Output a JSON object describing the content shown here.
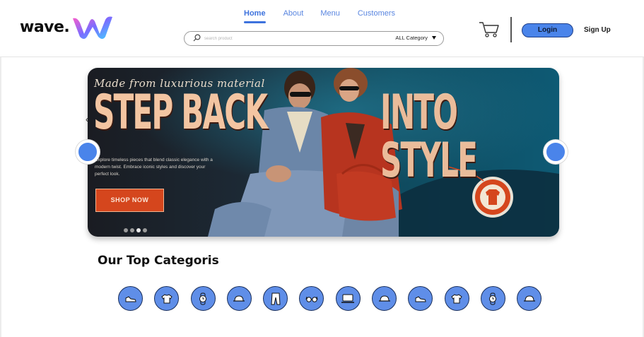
{
  "brand": {
    "name": "wave.",
    "accent": "#4a84ea",
    "logo_gradient": [
      "#ff5cc8",
      "#7b6cff",
      "#3fd0ff"
    ]
  },
  "nav": {
    "items": [
      {
        "label": "Home",
        "active": true
      },
      {
        "label": "About",
        "active": false
      },
      {
        "label": "Menu",
        "active": false
      },
      {
        "label": "Customers",
        "active": false
      }
    ]
  },
  "search": {
    "placeholder": "search product",
    "category": "ALL Category"
  },
  "header_actions": {
    "cart_icon": "cart-icon",
    "login_label": "Login",
    "signup_label": "Sign Up"
  },
  "hero": {
    "subtitle": "Made from luxurious material",
    "title_left": "STEP BACK",
    "title_right": "INTO STYLE",
    "description": "Explore timeless pieces that blend classic elegance with a modern twist. Embrace iconic styles and discover your perfect look.",
    "cta_label": "SHOP NOW",
    "slide_count": 4,
    "active_slide": 3
  },
  "categories": {
    "title": "Our Top Categoris",
    "items": [
      "shoe-icon",
      "tshirt-icon",
      "watch-icon",
      "cap-icon",
      "pants-icon",
      "glasses-icon",
      "laptop-icon",
      "cap-icon",
      "shoe-icon",
      "tshirt-icon",
      "watch-icon",
      "cap-icon"
    ]
  }
}
